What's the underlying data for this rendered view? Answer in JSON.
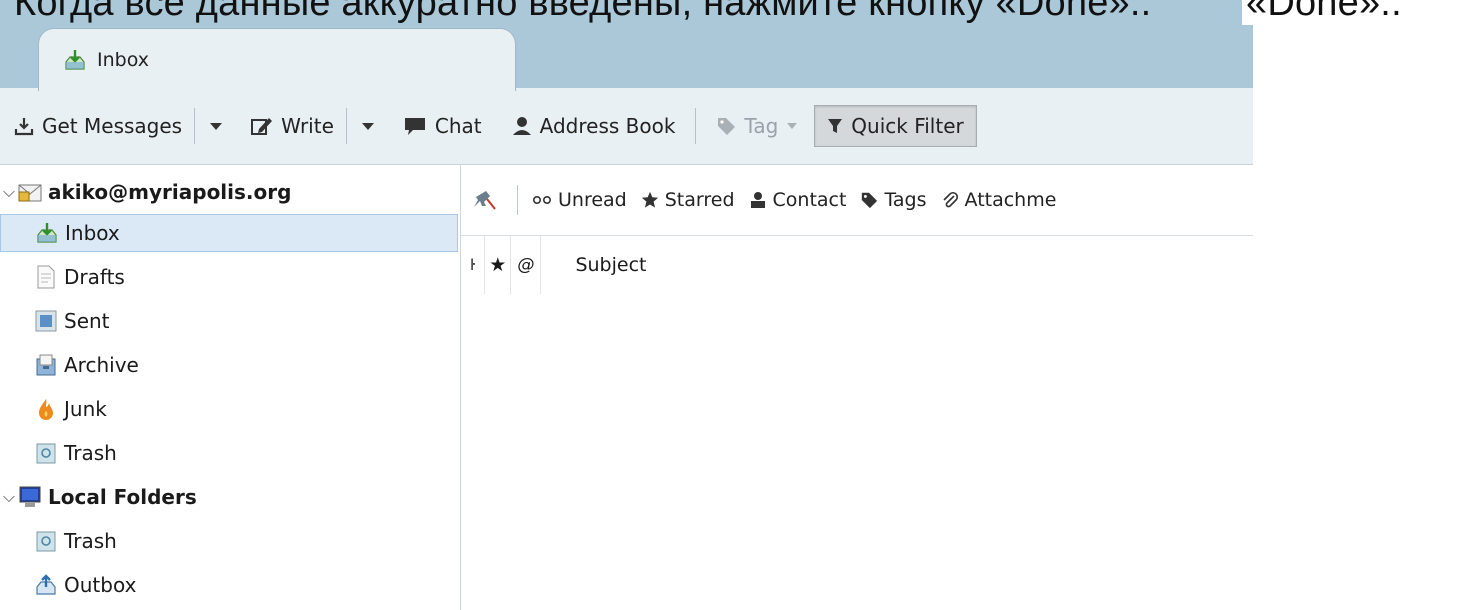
{
  "caption": {
    "text": "Когда все данные аккуратно введены, нажмите кнопку «Done»..",
    "tail": "«Done».."
  },
  "tab": {
    "label": "Inbox"
  },
  "toolbar": {
    "get_messages": "Get Messages",
    "write": "Write",
    "chat": "Chat",
    "address_book": "Address Book",
    "tag": "Tag",
    "quick_filter": "Quick Filter"
  },
  "filterbar": {
    "unread": "Unread",
    "starred": "Starred",
    "contact": "Contact",
    "tags": "Tags",
    "attachment": "Attachme"
  },
  "columns": {
    "thread": "ŀ",
    "star": "★",
    "attach": "@",
    "subject": "Subject"
  },
  "sidebar": {
    "account": "akiko@myriapolis.org",
    "folders": [
      "Inbox",
      "Drafts",
      "Sent",
      "Archive",
      "Junk",
      "Trash"
    ],
    "local": "Local Folders",
    "local_folders": [
      "Trash",
      "Outbox"
    ]
  },
  "colors": {
    "tabbar": "#abc8d9",
    "toolbar": "#e9f0f4",
    "selected": "#dbe9f7"
  }
}
